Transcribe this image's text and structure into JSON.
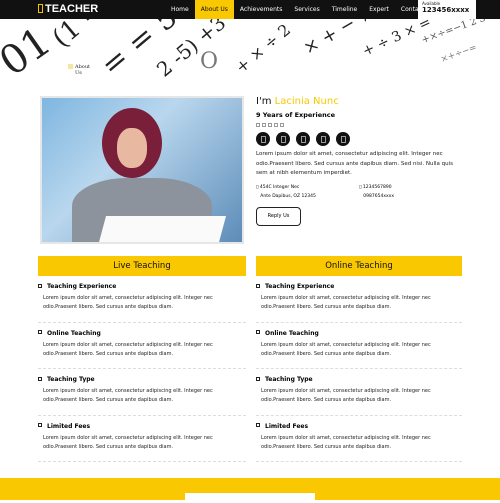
{
  "nav": {
    "logo": "TEACHER",
    "items": [
      "Home",
      "About Us",
      "Achievements",
      "Services",
      "Timeline",
      "Expert",
      "Contact Us"
    ],
    "active": "About Us",
    "phone_label": "Available",
    "phone": "123456xxxx"
  },
  "breadcrumb": "About Us",
  "profile": {
    "intro": "I'm",
    "name": "Lacinia Nunc",
    "experience": "9 Years of Experience",
    "rating": 5,
    "description": "Lorem ipsum dolor sit amet, consectetur adipiscing elit. Integer nec odio.Praesent libero. Sed cursus ante dapibus diam. Sed nisi. Nulla quis sem at nibh elementum imperdiet.",
    "address": [
      "454C Integer Nec",
      "Ante Dapibus, OZ 12345"
    ],
    "phones": [
      "1234567890",
      "0987654xxxx"
    ],
    "button": "Reply Us"
  },
  "columns": [
    {
      "title": "Live Teaching",
      "items": [
        {
          "title": "Teaching Experience",
          "text": "Lorem ipsum dolor sit amet, consectetur adipiscing elit. Integer nec odio.Praesent libero. Sed cursus ante dapibus diam."
        },
        {
          "title": "Online Teaching",
          "text": "Lorem ipsum dolor sit amet, consectetur adipiscing elit. Integer nec odio.Praesent libero. Sed cursus ante dapibus diam."
        },
        {
          "title": "Teaching Type",
          "text": "Lorem ipsum dolor sit amet, consectetur adipiscing elit. Integer nec odio.Praesent libero. Sed cursus ante dapibus diam."
        },
        {
          "title": "Limited Fees",
          "text": "Lorem ipsum dolor sit amet, consectetur adipiscing elit. Integer nec odio.Praesent libero. Sed cursus ante dapibus diam."
        }
      ]
    },
    {
      "title": "Online Teaching",
      "items": [
        {
          "title": "Teaching Experience",
          "text": "Lorem ipsum dolor sit amet, consectetur adipiscing elit. Integer nec odio.Praesent libero. Sed cursus ante dapibus diam."
        },
        {
          "title": "Online Teaching",
          "text": "Lorem ipsum dolor sit amet, consectetur adipiscing elit. Integer nec odio.Praesent libero. Sed cursus ante dapibus diam."
        },
        {
          "title": "Teaching Type",
          "text": "Lorem ipsum dolor sit amet, consectetur adipiscing elit. Integer nec odio.Praesent libero. Sed cursus ante dapibus diam."
        },
        {
          "title": "Limited Fees",
          "text": "Lorem ipsum dolor sit amet, consectetur adipiscing elit. Integer nec odio.Praesent libero. Sed cursus ante dapibus diam."
        }
      ]
    }
  ],
  "colors": {
    "accent": "#f9c800",
    "dark": "#111111"
  }
}
